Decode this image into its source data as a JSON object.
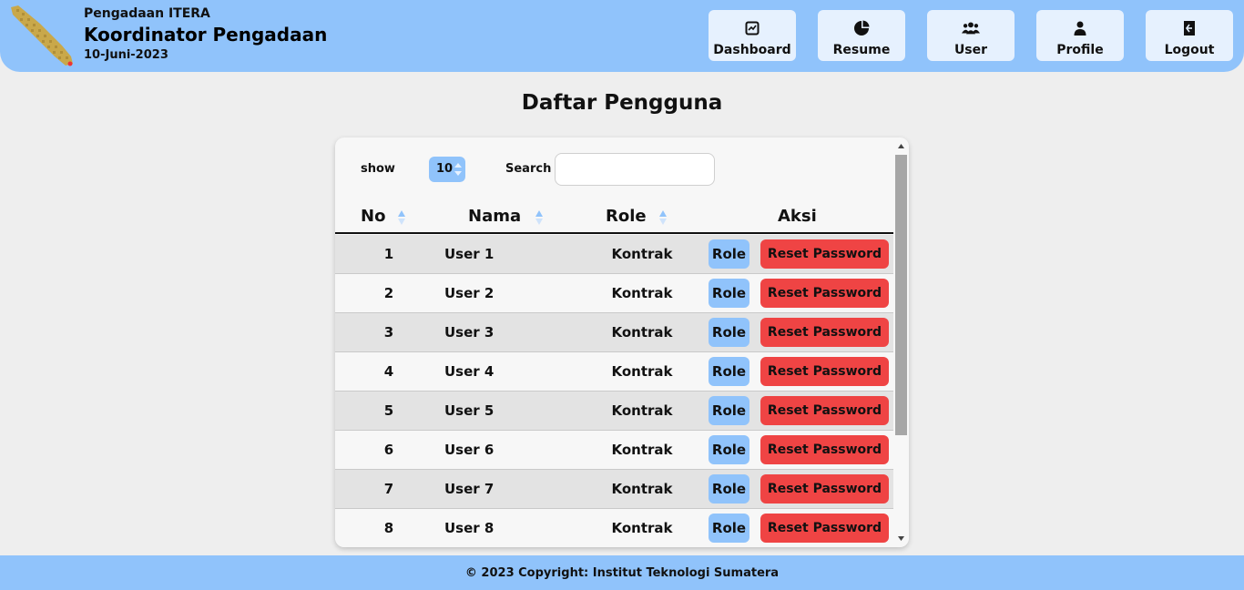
{
  "header": {
    "org": "Pengadaan ITERA",
    "role_title": "Koordinator Pengadaan",
    "date": "10-Juni-2023",
    "logo_icon": "sumatra-island-logo-icon",
    "nav": [
      {
        "label": "Dashboard",
        "icon": "dashboard-icon"
      },
      {
        "label": "Resume",
        "icon": "pie-chart-icon"
      },
      {
        "label": "User",
        "icon": "users-icon"
      },
      {
        "label": "Profile",
        "icon": "person-icon"
      },
      {
        "label": "Logout",
        "icon": "logout-door-icon"
      }
    ]
  },
  "page_title": "Daftar Pengguna",
  "table": {
    "show_label": "show",
    "show_value": "10",
    "search_label": "Search",
    "search_value": "",
    "columns": [
      "No",
      "Nama",
      "Role",
      "Aksi"
    ],
    "rows": [
      {
        "no": "1",
        "nama": "User 1",
        "role": "Kontrak",
        "role_btn": "Role",
        "reset_btn": "Reset Password"
      },
      {
        "no": "2",
        "nama": "User 2",
        "role": "Kontrak",
        "role_btn": "Role",
        "reset_btn": "Reset Password"
      },
      {
        "no": "3",
        "nama": "User 3",
        "role": "Kontrak",
        "role_btn": "Role",
        "reset_btn": "Reset Password"
      },
      {
        "no": "4",
        "nama": "User 4",
        "role": "Kontrak",
        "role_btn": "Role",
        "reset_btn": "Reset Password"
      },
      {
        "no": "5",
        "nama": "User 5",
        "role": "Kontrak",
        "role_btn": "Role",
        "reset_btn": "Reset Password"
      },
      {
        "no": "6",
        "nama": "User 6",
        "role": "Kontrak",
        "role_btn": "Role",
        "reset_btn": "Reset Password"
      },
      {
        "no": "7",
        "nama": "User 7",
        "role": "Kontrak",
        "role_btn": "Role",
        "reset_btn": "Reset Password"
      },
      {
        "no": "8",
        "nama": "User 8",
        "role": "Kontrak",
        "role_btn": "Role",
        "reset_btn": "Reset Password"
      }
    ]
  },
  "footer": {
    "text": "© 2023 Copyright: Institut Teknologi Sumatera"
  },
  "colors": {
    "primary": "#90c3fb",
    "nav_button": "#e6f1fe",
    "danger": "#ef4444",
    "background": "#eeeeee"
  }
}
